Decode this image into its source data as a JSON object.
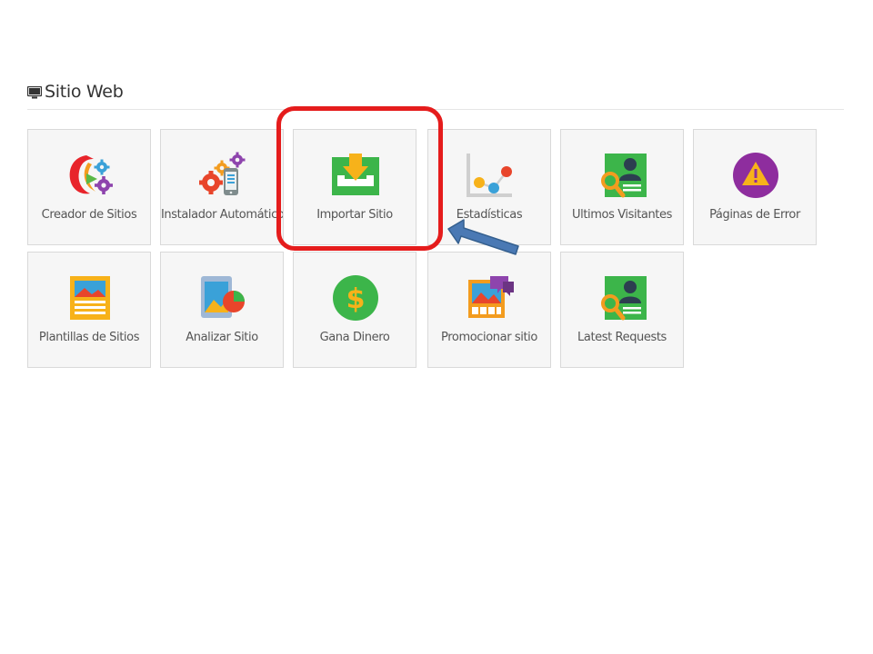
{
  "section": {
    "title": "Sitio Web",
    "icon": "monitor-icon"
  },
  "tiles": [
    {
      "label": "Creador de Sitios",
      "icon": "site-builder-icon"
    },
    {
      "label": "Instalador Automático",
      "icon": "auto-installer-icon"
    },
    {
      "label": "Importar Sitio",
      "icon": "import-site-icon"
    },
    {
      "label": "Estadísticas",
      "icon": "statistics-icon"
    },
    {
      "label": "Últimos Visitantes",
      "icon": "latest-visitors-icon"
    },
    {
      "label": "Páginas de Error",
      "icon": "error-pages-icon"
    },
    {
      "label": "Plantillas de Sitios",
      "icon": "site-templates-icon"
    },
    {
      "label": "Analizar Sitio",
      "icon": "analyze-site-icon"
    },
    {
      "label": "Gana Dinero",
      "icon": "earn-money-icon"
    },
    {
      "label": "Promocionar sitio",
      "icon": "promote-site-icon"
    },
    {
      "label": "Latest Requests",
      "icon": "latest-requests-icon"
    }
  ],
  "annotation": {
    "highlighted_tile": "Importar Sitio",
    "highlight_color": "#e51c1c",
    "arrow_color": "#4a79b4"
  }
}
